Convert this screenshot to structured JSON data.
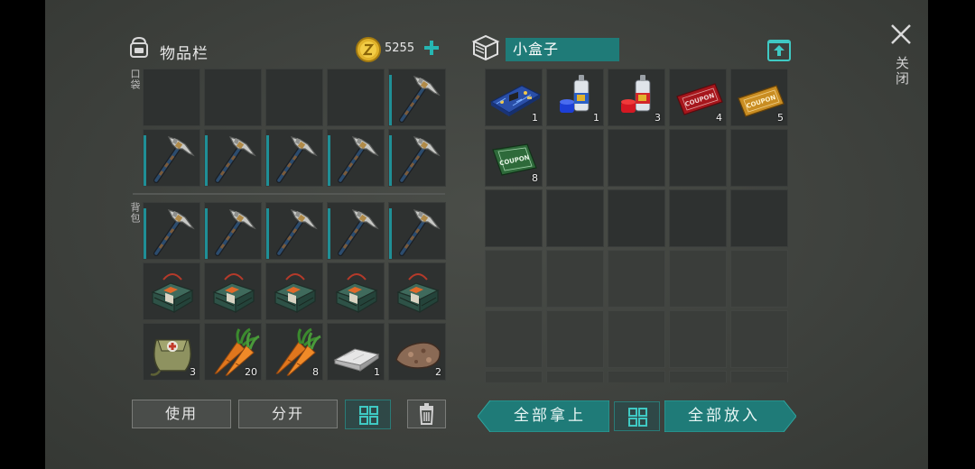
{
  "inventory": {
    "title": "物品栏",
    "coins": "5255",
    "pocket_label": "口袋",
    "backpack_label": "背包",
    "pocket_slots": [
      {
        "icon": "empty-slot",
        "count": ""
      },
      {
        "icon": "empty-slot",
        "count": ""
      },
      {
        "icon": "empty-slot",
        "count": ""
      },
      {
        "icon": "empty-slot",
        "count": ""
      },
      {
        "icon": "pickaxe-icon",
        "count": ""
      },
      {
        "icon": "pickaxe-icon",
        "count": ""
      },
      {
        "icon": "pickaxe-icon",
        "count": ""
      },
      {
        "icon": "pickaxe-icon",
        "count": ""
      },
      {
        "icon": "pickaxe-icon",
        "count": ""
      },
      {
        "icon": "pickaxe-icon",
        "count": ""
      }
    ],
    "backpack_slots": [
      {
        "icon": "pickaxe-icon",
        "count": ""
      },
      {
        "icon": "pickaxe-icon",
        "count": ""
      },
      {
        "icon": "pickaxe-icon",
        "count": ""
      },
      {
        "icon": "pickaxe-icon",
        "count": ""
      },
      {
        "icon": "pickaxe-icon",
        "count": ""
      },
      {
        "icon": "explosive-charge-icon",
        "count": ""
      },
      {
        "icon": "explosive-charge-icon",
        "count": ""
      },
      {
        "icon": "explosive-charge-icon",
        "count": ""
      },
      {
        "icon": "explosive-charge-icon",
        "count": ""
      },
      {
        "icon": "explosive-charge-icon",
        "count": ""
      },
      {
        "icon": "medkit-bag-icon",
        "count": "3"
      },
      {
        "icon": "carrot-icon",
        "count": "20"
      },
      {
        "icon": "carrot-icon",
        "count": "8"
      },
      {
        "icon": "metal-ingot-icon",
        "count": "1"
      },
      {
        "icon": "stone-ore-icon",
        "count": "2"
      }
    ],
    "buttons": {
      "use": "使用",
      "split": "分开"
    }
  },
  "container": {
    "name": "小盒子",
    "slots": [
      {
        "icon": "circuit-board-icon",
        "count": "1"
      },
      {
        "icon": "blue-spray-paint-icon",
        "count": "1"
      },
      {
        "icon": "red-spray-paint-icon",
        "count": "3"
      },
      {
        "icon": "red-coupon-icon",
        "count": "4"
      },
      {
        "icon": "gold-coupon-icon",
        "count": "5"
      },
      {
        "icon": "green-coupon-icon",
        "count": "8"
      }
    ],
    "coupon_text": "COUPON",
    "buttons": {
      "take_all": "全部拿上",
      "put_all": "全部放入"
    }
  },
  "close_label": "关闭",
  "colors": {
    "accent": "#1f7b78",
    "accent_light": "#26b6b2",
    "background": "#3f423e",
    "slot": "#2e3130"
  }
}
